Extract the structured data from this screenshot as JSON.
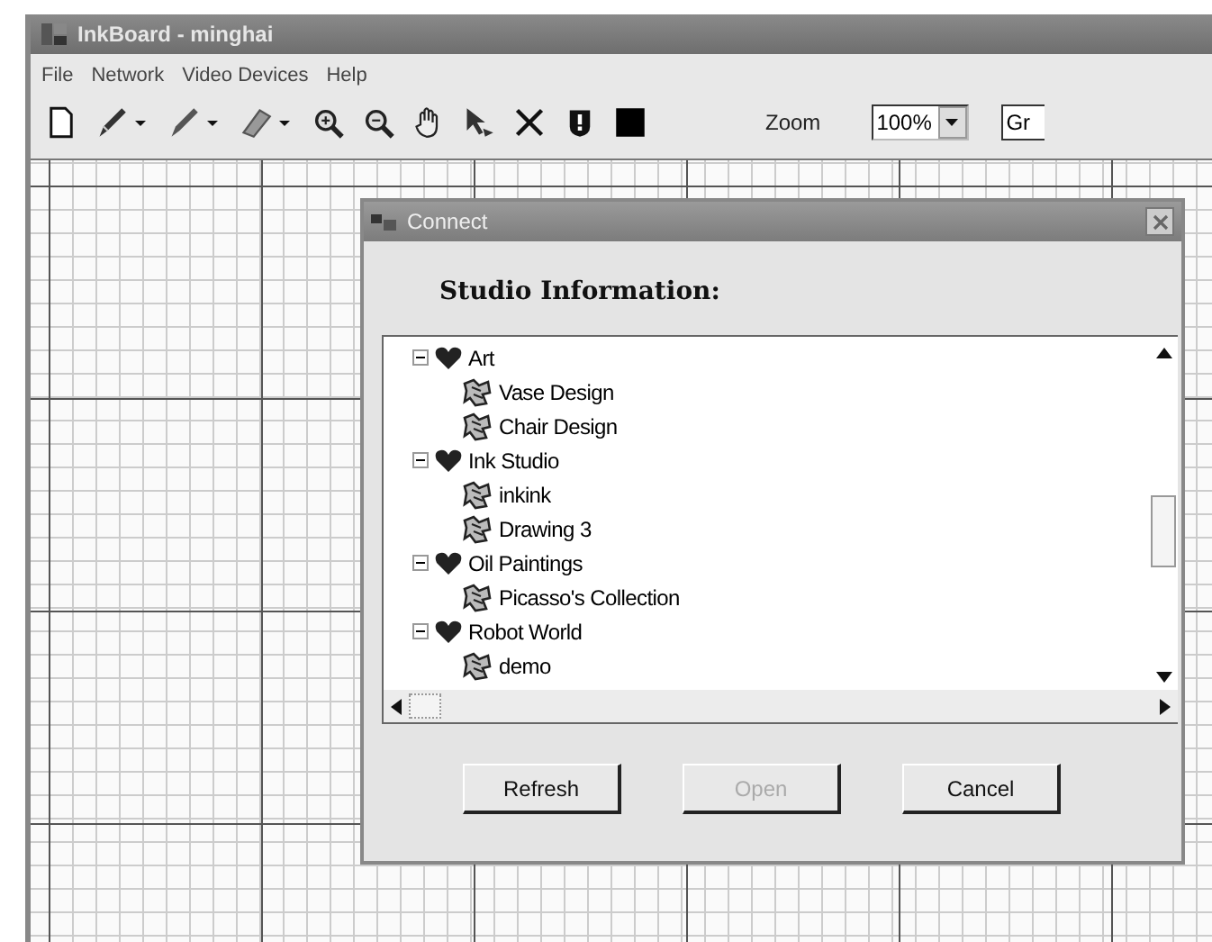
{
  "window": {
    "title": "InkBoard - minghai"
  },
  "menu": [
    "File",
    "Network",
    "Video Devices",
    "Help"
  ],
  "toolbar": {
    "zoom_label": "Zoom",
    "zoom_value": "100%",
    "combo_2_value": "Gr"
  },
  "dialog": {
    "title": "Connect",
    "heading": "Studio Information:",
    "tree": [
      {
        "label": "Art",
        "kind": "studio",
        "expanded": true,
        "children": [
          {
            "label": "Vase Design",
            "kind": "drawing"
          },
          {
            "label": "Chair Design",
            "kind": "drawing"
          }
        ]
      },
      {
        "label": "Ink Studio",
        "kind": "studio",
        "expanded": true,
        "children": [
          {
            "label": "inkink",
            "kind": "drawing"
          },
          {
            "label": "Drawing 3",
            "kind": "drawing"
          }
        ]
      },
      {
        "label": "Oil Paintings",
        "kind": "studio",
        "expanded": true,
        "children": [
          {
            "label": "Picasso's Collection",
            "kind": "drawing"
          }
        ]
      },
      {
        "label": "Robot World",
        "kind": "studio",
        "expanded": true,
        "children": [
          {
            "label": "demo",
            "kind": "drawing"
          }
        ]
      }
    ],
    "buttons": [
      {
        "label": "Refresh",
        "disabled": false
      },
      {
        "label": "Open",
        "disabled": true
      },
      {
        "label": "Cancel",
        "disabled": false
      }
    ]
  }
}
